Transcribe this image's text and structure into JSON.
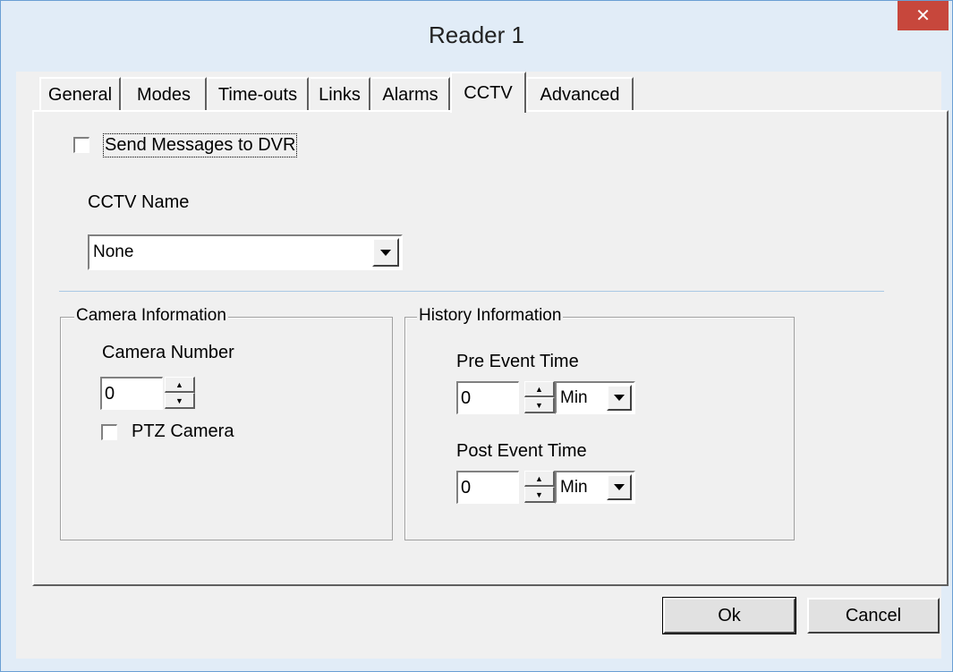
{
  "window": {
    "title": "Reader 1",
    "close_glyph": "✕"
  },
  "tabs": [
    {
      "label": "General"
    },
    {
      "label": "Modes"
    },
    {
      "label": "Time-outs"
    },
    {
      "label": "Links"
    },
    {
      "label": "Alarms"
    },
    {
      "label": "CCTV",
      "active": true
    },
    {
      "label": "Advanced"
    }
  ],
  "cctv": {
    "send_messages_label": "Send Messages to DVR",
    "send_messages_checked": false,
    "cctv_name_label": "CCTV Name",
    "cctv_name_value": "None"
  },
  "camera": {
    "group_title": "Camera Information",
    "number_label": "Camera Number",
    "number_value": "0",
    "ptz_label": "PTZ Camera",
    "ptz_checked": false
  },
  "history": {
    "group_title": "History Information",
    "pre_label": "Pre Event Time",
    "pre_value": "0",
    "pre_unit": "Min",
    "post_label": "Post Event Time",
    "post_value": "0",
    "post_unit": "Min"
  },
  "buttons": {
    "ok": "Ok",
    "cancel": "Cancel"
  },
  "icons": {
    "spin_up": "▲",
    "spin_down": "▼"
  },
  "colors": {
    "close_button": "#c7473c",
    "frame": "#6a9fd4",
    "dialog_bg": "#f0f0f0"
  }
}
